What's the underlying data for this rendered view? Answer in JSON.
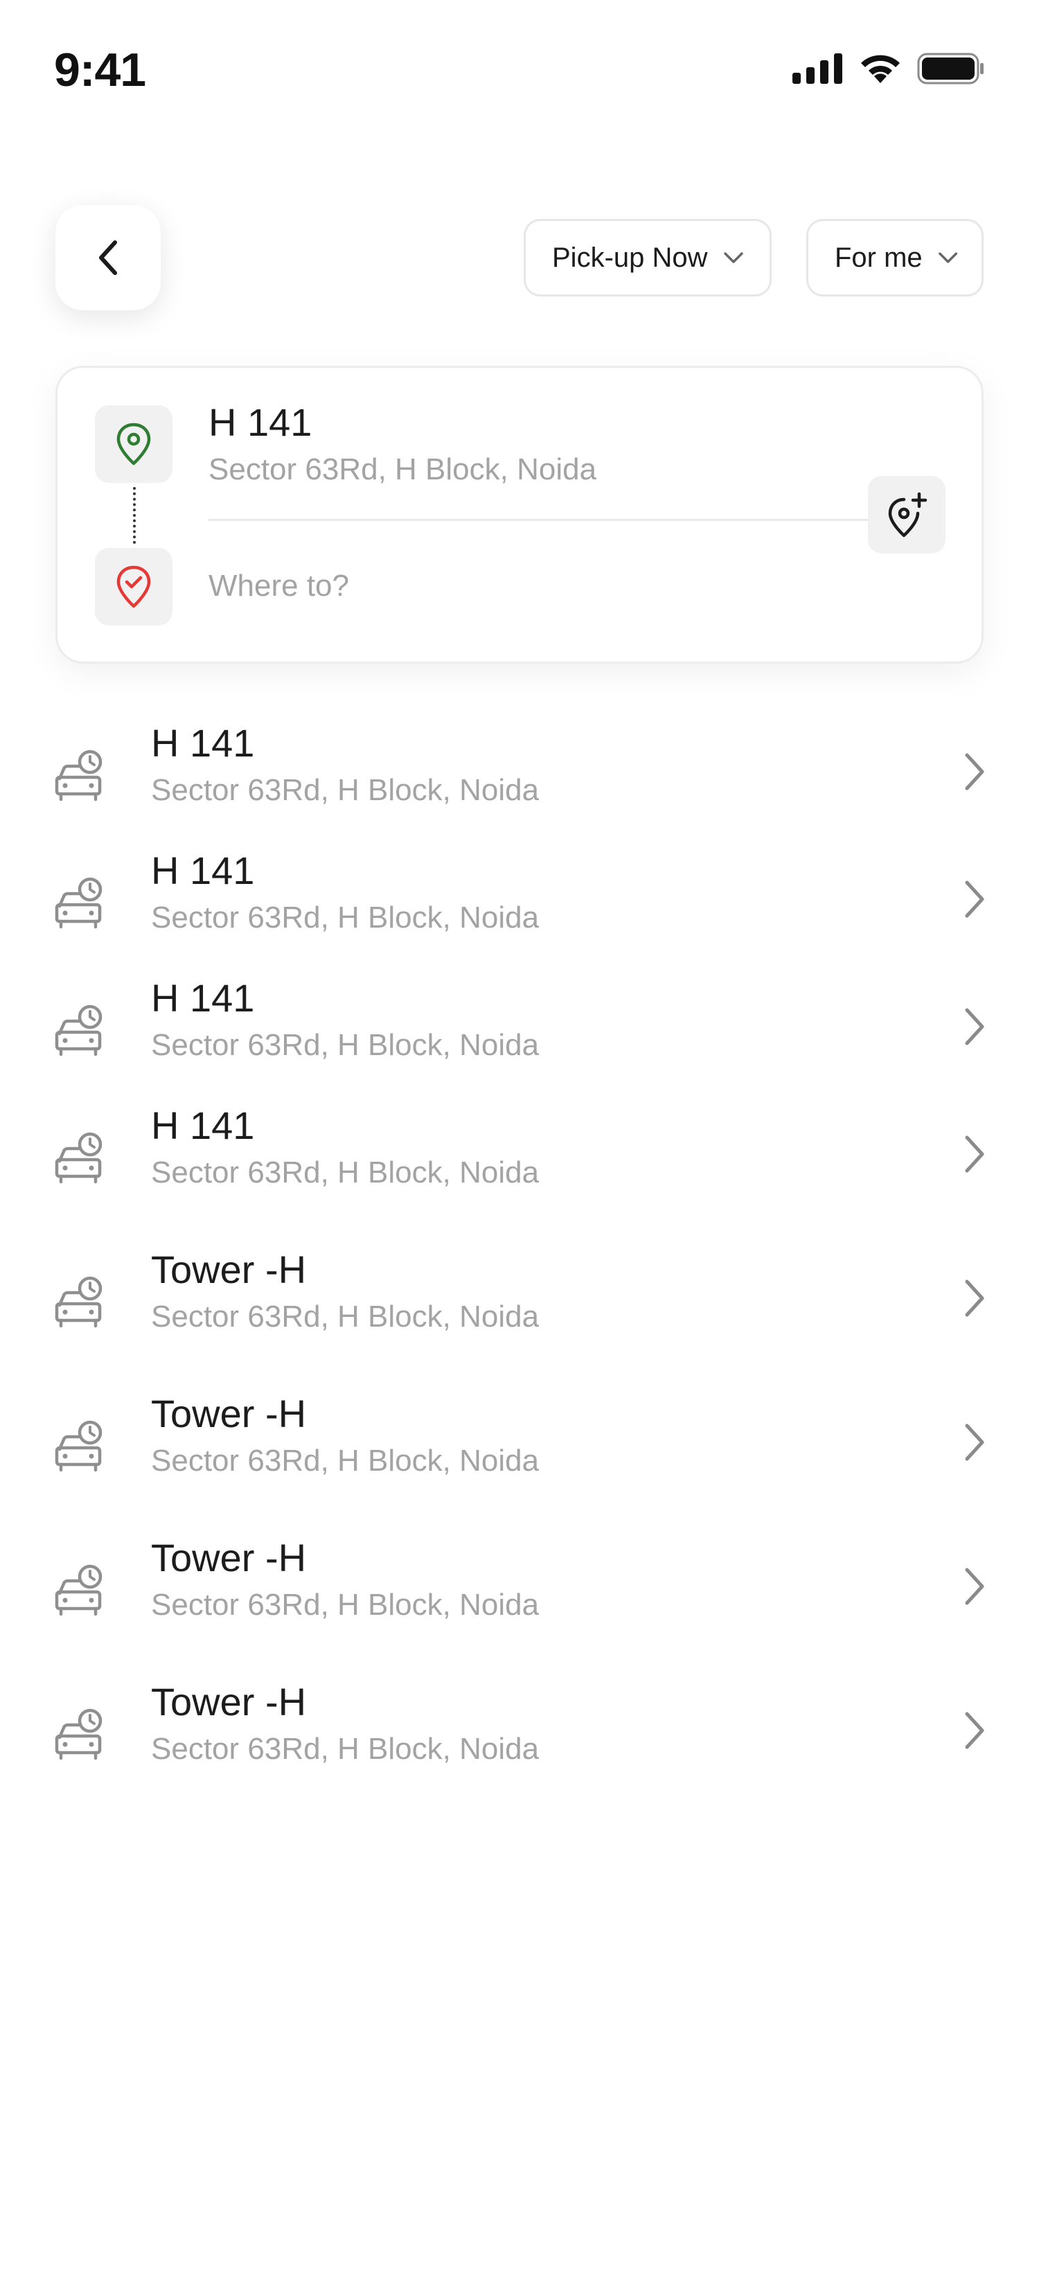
{
  "status_bar": {
    "time": "9:41",
    "icons": [
      "cellular-signal-icon",
      "wifi-icon",
      "battery-icon"
    ]
  },
  "header": {
    "back_icon": "chevron-left-icon",
    "pickup_chip": {
      "label": "Pick-up Now",
      "icon": "chevron-down-icon"
    },
    "rider_chip": {
      "label": "For me",
      "icon": "chevron-down-icon"
    }
  },
  "location_card": {
    "from": {
      "icon": "location-pin-icon",
      "title": "H 141",
      "subtitle": "Sector 63Rd, H Block, Noida"
    },
    "to": {
      "icon": "destination-check-pin-icon",
      "value": "",
      "placeholder": "Where to?"
    },
    "add_stop_icon": "add-location-icon",
    "colors": {
      "from_pin": "#2e7d32",
      "to_pin": "#e53935"
    }
  },
  "recent_places": [
    {
      "title": "H 141",
      "subtitle": "Sector 63Rd, H Block, Noida"
    },
    {
      "title": "H 141",
      "subtitle": "Sector 63Rd, H Block, Noida"
    },
    {
      "title": "H 141",
      "subtitle": "Sector 63Rd, H Block, Noida"
    },
    {
      "title": "H 141",
      "subtitle": "Sector 63Rd, H Block, Noida"
    },
    {
      "title": "Tower -H",
      "subtitle": "Sector 63Rd, H Block, Noida"
    },
    {
      "title": "Tower -H",
      "subtitle": "Sector 63Rd, H Block, Noida"
    },
    {
      "title": "Tower -H",
      "subtitle": "Sector 63Rd, H Block, Noida"
    },
    {
      "title": "Tower -H",
      "subtitle": "Sector 63Rd, H Block, Noida"
    }
  ],
  "recent_item_icons": {
    "leading": "car-history-icon",
    "trailing": "chevron-right-icon"
  }
}
